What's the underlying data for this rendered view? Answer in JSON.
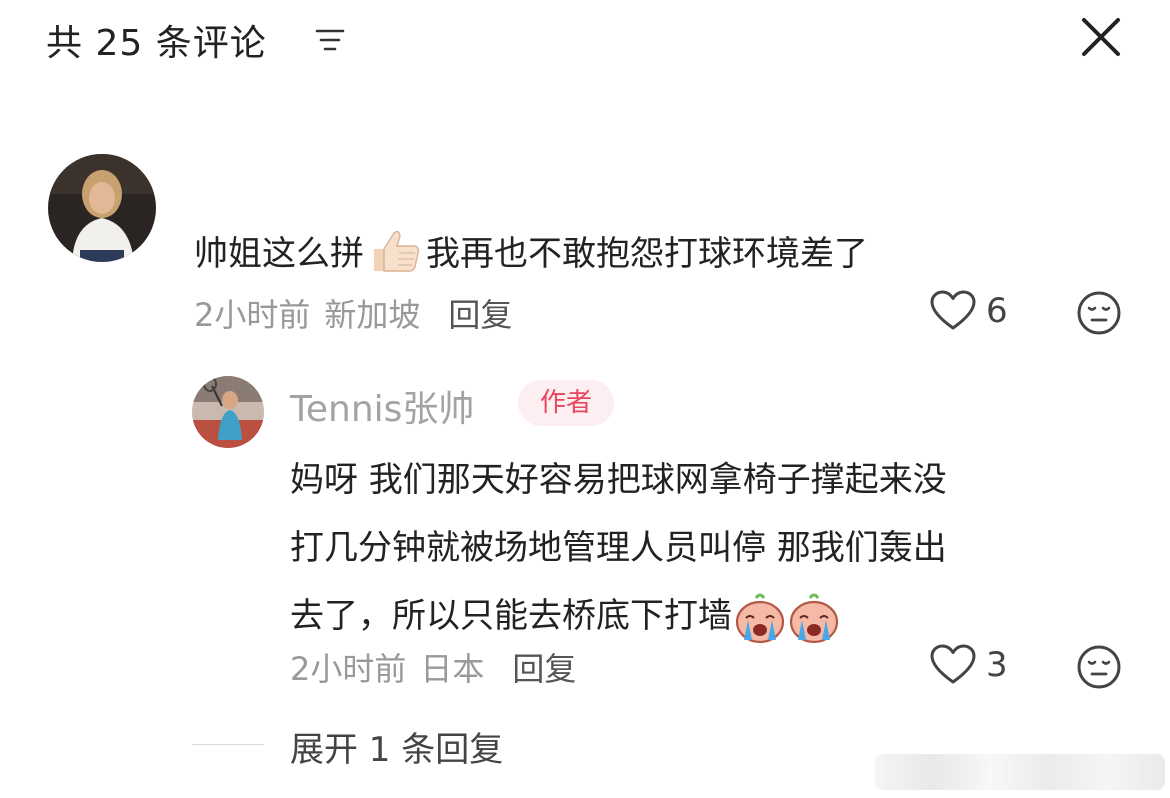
{
  "header": {
    "title": "共 25 条评论",
    "sort_icon": "sort-lines-icon",
    "close_icon": "close-icon"
  },
  "comments": [
    {
      "avatar": "avatar-woman-white-shirt",
      "text_before": "帅姐这么拼",
      "emoji": "thumbs-up-emoji",
      "text_after": "我再也不敢抱怨打球环境差了",
      "time": "2小时前",
      "location": "新加坡",
      "reply_label": "回复",
      "like_count": "6"
    }
  ],
  "reply": {
    "avatar": "avatar-tennis-player",
    "author": "Tennis张帅",
    "badge": "作者",
    "lines": [
      "妈呀 我们那天好容易把球网拿椅子撑起来没",
      "打几分钟就被场地管理人员叫停 那我们轰出",
      "去了，所以只能去桥底下打墙"
    ],
    "emoji": "crying-emoji",
    "time": "2小时前",
    "location": "日本",
    "reply_label": "回复",
    "like_count": "3"
  },
  "expand": {
    "label": "展开 1 条回复"
  },
  "colors": {
    "badge_bg": "#fdeef1",
    "badge_text": "#e8455e",
    "meta": "#999999"
  }
}
